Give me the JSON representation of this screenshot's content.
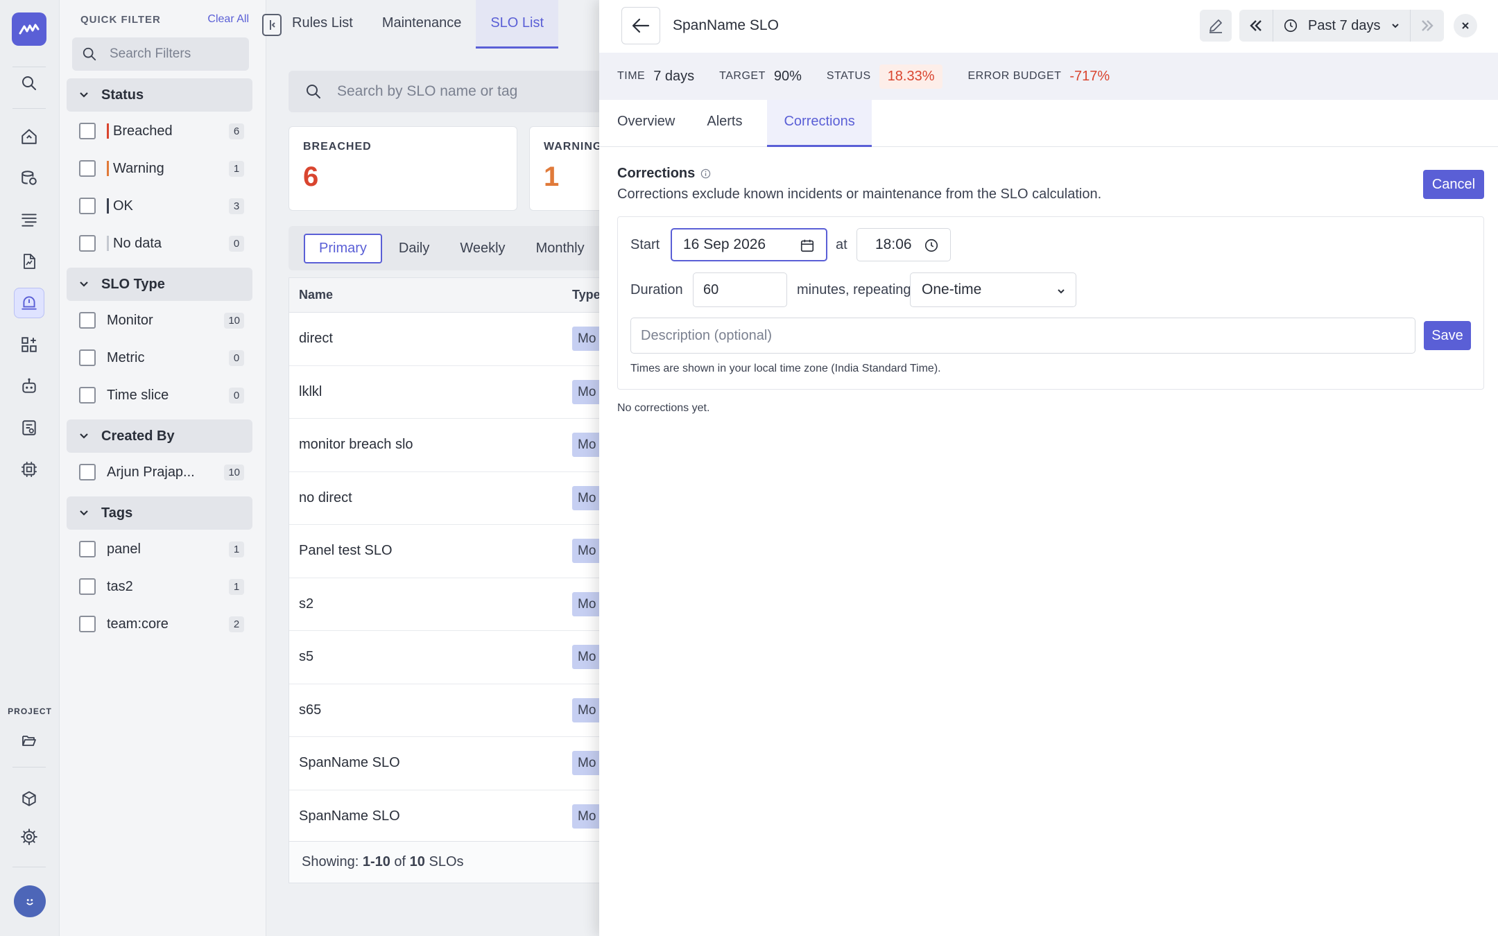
{
  "app": {
    "accent_color": "#5a5fd6",
    "error_color": "#d9452f",
    "warning_color": "#e07a3a"
  },
  "rail": {
    "icons": [
      "logo-icon",
      "search-icon",
      "home-icon",
      "database-icon",
      "logs-icon",
      "document-icon",
      "alert-icon",
      "dashboard-icon",
      "bot-icon",
      "report-icon",
      "cpu-icon",
      "folder-icon",
      "package-icon",
      "gear-icon",
      "avatar-icon"
    ],
    "project_label": "PROJECT"
  },
  "quick_filter": {
    "title": "QUICK FILTER",
    "clear_label": "Clear All",
    "search_placeholder": "Search Filters",
    "sections": {
      "status": {
        "title": "Status",
        "items": [
          {
            "label": "Breached",
            "count": "6",
            "color": "#d9452f"
          },
          {
            "label": "Warning",
            "count": "1",
            "color": "#e07a3a"
          },
          {
            "label": "OK",
            "count": "3",
            "color": "#3b4150"
          },
          {
            "label": "No data",
            "count": "0",
            "color": "#c4c8d0"
          }
        ]
      },
      "slo_type": {
        "title": "SLO Type",
        "items": [
          {
            "label": "Monitor",
            "count": "10"
          },
          {
            "label": "Metric",
            "count": "0"
          },
          {
            "label": "Time slice",
            "count": "0"
          }
        ]
      },
      "created_by": {
        "title": "Created By",
        "items": [
          {
            "label": "Arjun Prajap...",
            "count": "10"
          }
        ]
      },
      "tags": {
        "title": "Tags",
        "items": [
          {
            "label": "panel",
            "count": "1"
          },
          {
            "label": "tas2",
            "count": "1"
          },
          {
            "label": "team:core",
            "count": "2"
          }
        ]
      }
    }
  },
  "main": {
    "tabs": [
      "Rules List",
      "Maintenance",
      "SLO List"
    ],
    "search_placeholder": "Search by SLO name or tag",
    "stats": [
      {
        "label": "BREACHED",
        "value": "6"
      },
      {
        "label": "WARNING",
        "value": "1"
      }
    ],
    "periods": [
      "Primary",
      "Daily",
      "Weekly",
      "Monthly"
    ],
    "table": {
      "headers": [
        "Name",
        "Type"
      ],
      "rows": [
        {
          "name": "direct",
          "type": "Mo"
        },
        {
          "name": "lklkl",
          "type": "Mo"
        },
        {
          "name": "monitor breach slo",
          "type": "Mo"
        },
        {
          "name": "no direct",
          "type": "Mo"
        },
        {
          "name": "Panel test SLO",
          "type": "Mo"
        },
        {
          "name": "s2",
          "type": "Mo"
        },
        {
          "name": "s5",
          "type": "Mo"
        },
        {
          "name": "s65",
          "type": "Mo"
        },
        {
          "name": "SpanName SLO",
          "type": "Mo"
        },
        {
          "name": "SpanName SLO",
          "type": "Mo"
        }
      ],
      "footer": {
        "prefix": "Showing: ",
        "range": "1-10",
        "of": " of ",
        "total": "10",
        "suffix": " SLOs"
      }
    }
  },
  "drawer": {
    "title": "SpanName SLO",
    "time_range": "Past 7 days",
    "summary": {
      "time_label": "TIME",
      "time_value": "7 days",
      "target_label": "TARGET",
      "target_value": "90%",
      "status_label": "STATUS",
      "status_value": "18.33%",
      "error_label": "ERROR BUDGET",
      "error_value": "-717%"
    },
    "tabs": [
      "Overview",
      "Alerts",
      "Corrections"
    ],
    "corrections": {
      "title": "Corrections",
      "description": "Corrections exclude known incidents or maintenance from the SLO calculation.",
      "cancel_label": "Cancel",
      "start_label": "Start",
      "start_date": "16 Sep 2026",
      "at_label": "at",
      "start_time": "18:06",
      "duration_label": "Duration",
      "duration_value": "60",
      "repeating_label": "minutes, repeating",
      "repeat_value": "One-time",
      "description_placeholder": "Description (optional)",
      "save_label": "Save",
      "timezone_note": "Times are shown in your local time zone (India Standard Time).",
      "empty_text": "No corrections yet."
    }
  }
}
